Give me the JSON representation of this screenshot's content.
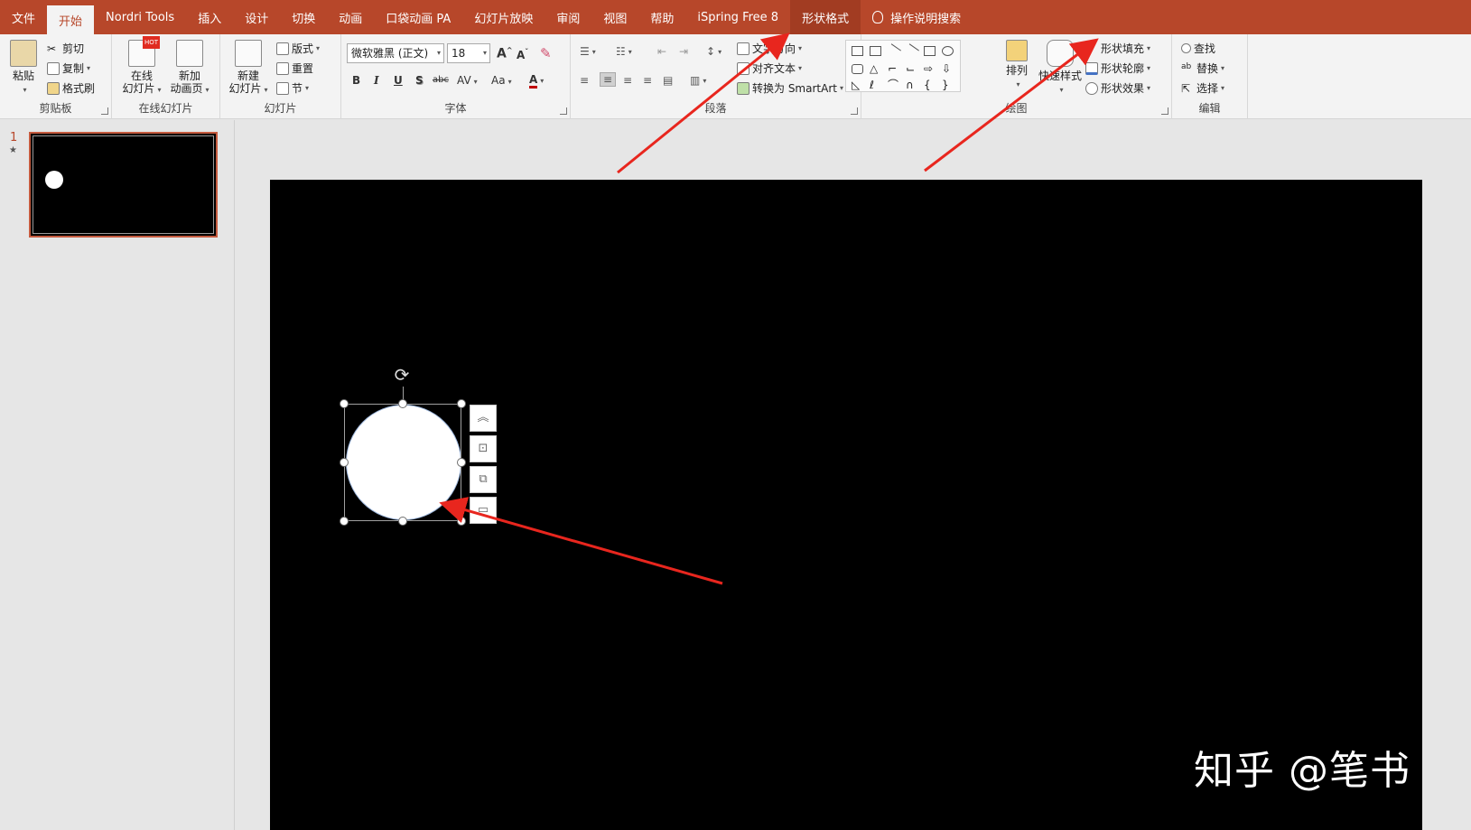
{
  "tabs": [
    {
      "label": "文件"
    },
    {
      "label": "开始",
      "active": true
    },
    {
      "label": "Nordri Tools"
    },
    {
      "label": "插入"
    },
    {
      "label": "设计"
    },
    {
      "label": "切换"
    },
    {
      "label": "动画"
    },
    {
      "label": "口袋动画 PA"
    },
    {
      "label": "幻灯片放映"
    },
    {
      "label": "审阅"
    },
    {
      "label": "视图"
    },
    {
      "label": "帮助"
    },
    {
      "label": "iSpring Free 8"
    },
    {
      "label": "形状格式",
      "context": true
    }
  ],
  "search_tab": "操作说明搜索",
  "clipboard": {
    "paste": "粘贴",
    "cut": "剪切",
    "copy": "复制",
    "format_painter": "格式刷",
    "label": "剪贴板"
  },
  "online_slides": {
    "online": "在线",
    "online2": "幻灯片",
    "new_anim": "新加",
    "new_anim2": "动画页",
    "hot": "HOT",
    "label": "在线幻灯片"
  },
  "slides": {
    "new": "新建",
    "new2": "幻灯片",
    "layout": "版式",
    "reset": "重置",
    "section": "节",
    "label": "幻灯片"
  },
  "font": {
    "name": "微软雅黑 (正文)",
    "size": "18",
    "bold": "B",
    "italic": "I",
    "underline": "U",
    "shadow": "S",
    "strike": "abc",
    "spacing": "AV",
    "case": "Aa",
    "color": "A",
    "label": "字体"
  },
  "paragraph": {
    "text_direction": "文字方向",
    "align_text": "对齐文本",
    "smartart": "转换为 SmartArt",
    "label": "段落"
  },
  "drawing": {
    "arrange": "排列",
    "quick_styles": "快速样式",
    "shape_fill": "形状填充",
    "shape_outline": "形状轮廓",
    "shape_effects": "形状效果",
    "label": "绘图"
  },
  "editing": {
    "find": "查找",
    "replace": "替换",
    "select": "选择",
    "label": "编辑"
  },
  "thumbnail": {
    "number": "1",
    "star": "★"
  },
  "watermark": "知乎 @笔书",
  "colors": {
    "accent": "#b7472a",
    "arrow": "#e8261e",
    "slide": "#000000",
    "shape_fill": "#ffffff"
  }
}
